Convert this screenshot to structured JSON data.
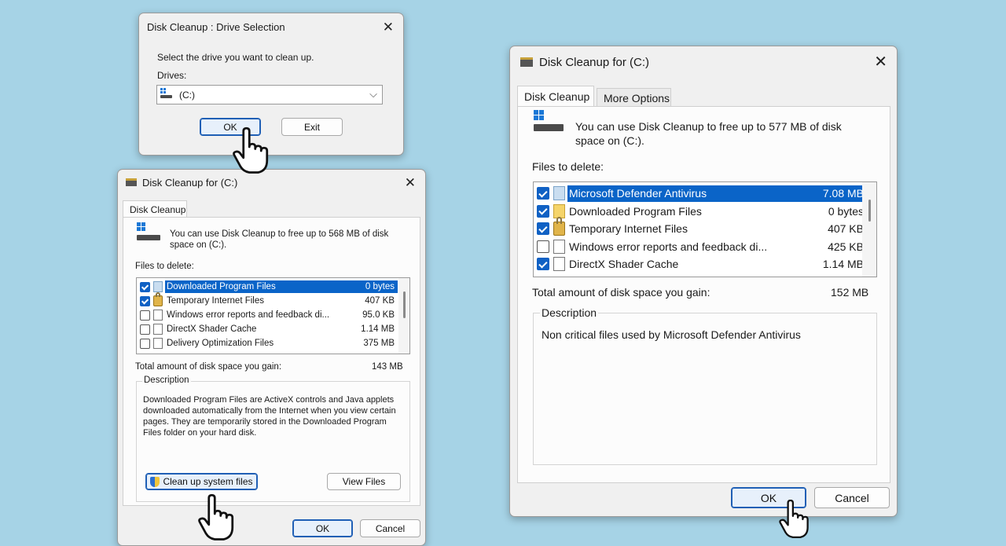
{
  "drive_selection": {
    "title": "Disk Cleanup : Drive Selection",
    "prompt": "Select the drive you want to clean up.",
    "drives_label": "Drives:",
    "selected_drive": "(C:)",
    "ok_label": "OK",
    "exit_label": "Exit"
  },
  "cleanup_small": {
    "title": "Disk Cleanup for  (C:)",
    "tab_label": "Disk Cleanup",
    "info_text": "You can use Disk Cleanup to free up to 568 MB of disk space on  (C:).",
    "files_label": "Files to delete:",
    "files": [
      {
        "name": "Downloaded Program Files",
        "size": "0 bytes",
        "checked": true,
        "icon": "blue-page-icon",
        "selected": true
      },
      {
        "name": "Temporary Internet Files",
        "size": "407 KB",
        "checked": true,
        "icon": "lock-icon",
        "selected": false
      },
      {
        "name": "Windows error reports and feedback di...",
        "size": "95.0 KB",
        "checked": false,
        "icon": "document-icon",
        "selected": false
      },
      {
        "name": "DirectX Shader Cache",
        "size": "1.14 MB",
        "checked": false,
        "icon": "document-icon",
        "selected": false
      },
      {
        "name": "Delivery Optimization Files",
        "size": "375 MB",
        "checked": false,
        "icon": "document-icon",
        "selected": false
      }
    ],
    "total_label": "Total amount of disk space you gain:",
    "total_value": "143 MB",
    "description_label": "Description",
    "description_text": "Downloaded Program Files are ActiveX controls and Java applets downloaded automatically from the Internet when you view certain pages. They are temporarily stored in the Downloaded Program Files folder on your hard disk.",
    "cleanup_system_label": "Clean up system files",
    "view_files_label": "View Files",
    "ok_label": "OK",
    "cancel_label": "Cancel"
  },
  "cleanup_large": {
    "title": "Disk Cleanup for  (C:)",
    "tabs": [
      "Disk Cleanup",
      "More Options"
    ],
    "info_text": "You can use Disk Cleanup to free up to 577 MB of disk space on  (C:).",
    "files_label": "Files to delete:",
    "files": [
      {
        "name": "Microsoft Defender Antivirus",
        "size": "7.08 MB",
        "checked": true,
        "icon": "blue-page-icon",
        "selected": true
      },
      {
        "name": "Downloaded Program Files",
        "size": "0 bytes",
        "checked": true,
        "icon": "folder-icon",
        "selected": false
      },
      {
        "name": "Temporary Internet Files",
        "size": "407 KB",
        "checked": true,
        "icon": "lock-icon",
        "selected": false
      },
      {
        "name": "Windows error reports and feedback di...",
        "size": "425 KB",
        "checked": false,
        "icon": "document-icon",
        "selected": false
      },
      {
        "name": "DirectX Shader Cache",
        "size": "1.14 MB",
        "checked": true,
        "icon": "document-icon",
        "selected": false
      }
    ],
    "total_label": "Total amount of disk space you gain:",
    "total_value": "152 MB",
    "description_label": "Description",
    "description_text": "Non critical files used by Microsoft Defender Antivirus",
    "ok_label": "OK",
    "cancel_label": "Cancel"
  },
  "colors": {
    "background": "#a6d3e6",
    "selection": "#0a64c8",
    "accent": "#1061c4"
  }
}
